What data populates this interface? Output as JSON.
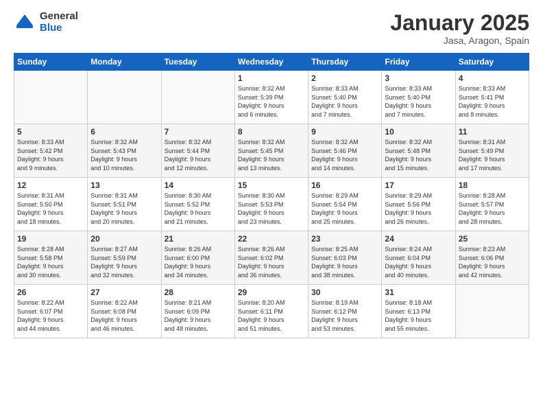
{
  "logo": {
    "general": "General",
    "blue": "Blue"
  },
  "header": {
    "month": "January 2025",
    "location": "Jasa, Aragon, Spain"
  },
  "weekdays": [
    "Sunday",
    "Monday",
    "Tuesday",
    "Wednesday",
    "Thursday",
    "Friday",
    "Saturday"
  ],
  "weeks": [
    [
      {
        "day": "",
        "info": ""
      },
      {
        "day": "",
        "info": ""
      },
      {
        "day": "",
        "info": ""
      },
      {
        "day": "1",
        "info": "Sunrise: 8:32 AM\nSunset: 5:39 PM\nDaylight: 9 hours\nand 6 minutes."
      },
      {
        "day": "2",
        "info": "Sunrise: 8:33 AM\nSunset: 5:40 PM\nDaylight: 9 hours\nand 7 minutes."
      },
      {
        "day": "3",
        "info": "Sunrise: 8:33 AM\nSunset: 5:40 PM\nDaylight: 9 hours\nand 7 minutes."
      },
      {
        "day": "4",
        "info": "Sunrise: 8:33 AM\nSunset: 5:41 PM\nDaylight: 9 hours\nand 8 minutes."
      }
    ],
    [
      {
        "day": "5",
        "info": "Sunrise: 8:33 AM\nSunset: 5:42 PM\nDaylight: 9 hours\nand 9 minutes."
      },
      {
        "day": "6",
        "info": "Sunrise: 8:32 AM\nSunset: 5:43 PM\nDaylight: 9 hours\nand 10 minutes."
      },
      {
        "day": "7",
        "info": "Sunrise: 8:32 AM\nSunset: 5:44 PM\nDaylight: 9 hours\nand 12 minutes."
      },
      {
        "day": "8",
        "info": "Sunrise: 8:32 AM\nSunset: 5:45 PM\nDaylight: 9 hours\nand 13 minutes."
      },
      {
        "day": "9",
        "info": "Sunrise: 8:32 AM\nSunset: 5:46 PM\nDaylight: 9 hours\nand 14 minutes."
      },
      {
        "day": "10",
        "info": "Sunrise: 8:32 AM\nSunset: 5:48 PM\nDaylight: 9 hours\nand 15 minutes."
      },
      {
        "day": "11",
        "info": "Sunrise: 8:31 AM\nSunset: 5:49 PM\nDaylight: 9 hours\nand 17 minutes."
      }
    ],
    [
      {
        "day": "12",
        "info": "Sunrise: 8:31 AM\nSunset: 5:50 PM\nDaylight: 9 hours\nand 18 minutes."
      },
      {
        "day": "13",
        "info": "Sunrise: 8:31 AM\nSunset: 5:51 PM\nDaylight: 9 hours\nand 20 minutes."
      },
      {
        "day": "14",
        "info": "Sunrise: 8:30 AM\nSunset: 5:52 PM\nDaylight: 9 hours\nand 21 minutes."
      },
      {
        "day": "15",
        "info": "Sunrise: 8:30 AM\nSunset: 5:53 PM\nDaylight: 9 hours\nand 23 minutes."
      },
      {
        "day": "16",
        "info": "Sunrise: 8:29 AM\nSunset: 5:54 PM\nDaylight: 9 hours\nand 25 minutes."
      },
      {
        "day": "17",
        "info": "Sunrise: 8:29 AM\nSunset: 5:56 PM\nDaylight: 9 hours\nand 26 minutes."
      },
      {
        "day": "18",
        "info": "Sunrise: 8:28 AM\nSunset: 5:57 PM\nDaylight: 9 hours\nand 28 minutes."
      }
    ],
    [
      {
        "day": "19",
        "info": "Sunrise: 8:28 AM\nSunset: 5:58 PM\nDaylight: 9 hours\nand 30 minutes."
      },
      {
        "day": "20",
        "info": "Sunrise: 8:27 AM\nSunset: 5:59 PM\nDaylight: 9 hours\nand 32 minutes."
      },
      {
        "day": "21",
        "info": "Sunrise: 8:26 AM\nSunset: 6:00 PM\nDaylight: 9 hours\nand 34 minutes."
      },
      {
        "day": "22",
        "info": "Sunrise: 8:26 AM\nSunset: 6:02 PM\nDaylight: 9 hours\nand 36 minutes."
      },
      {
        "day": "23",
        "info": "Sunrise: 8:25 AM\nSunset: 6:03 PM\nDaylight: 9 hours\nand 38 minutes."
      },
      {
        "day": "24",
        "info": "Sunrise: 8:24 AM\nSunset: 6:04 PM\nDaylight: 9 hours\nand 40 minutes."
      },
      {
        "day": "25",
        "info": "Sunrise: 8:23 AM\nSunset: 6:06 PM\nDaylight: 9 hours\nand 42 minutes."
      }
    ],
    [
      {
        "day": "26",
        "info": "Sunrise: 8:22 AM\nSunset: 6:07 PM\nDaylight: 9 hours\nand 44 minutes."
      },
      {
        "day": "27",
        "info": "Sunrise: 8:22 AM\nSunset: 6:08 PM\nDaylight: 9 hours\nand 46 minutes."
      },
      {
        "day": "28",
        "info": "Sunrise: 8:21 AM\nSunset: 6:09 PM\nDaylight: 9 hours\nand 48 minutes."
      },
      {
        "day": "29",
        "info": "Sunrise: 8:20 AM\nSunset: 6:11 PM\nDaylight: 9 hours\nand 51 minutes."
      },
      {
        "day": "30",
        "info": "Sunrise: 8:19 AM\nSunset: 6:12 PM\nDaylight: 9 hours\nand 53 minutes."
      },
      {
        "day": "31",
        "info": "Sunrise: 8:18 AM\nSunset: 6:13 PM\nDaylight: 9 hours\nand 55 minutes."
      },
      {
        "day": "",
        "info": ""
      }
    ]
  ]
}
